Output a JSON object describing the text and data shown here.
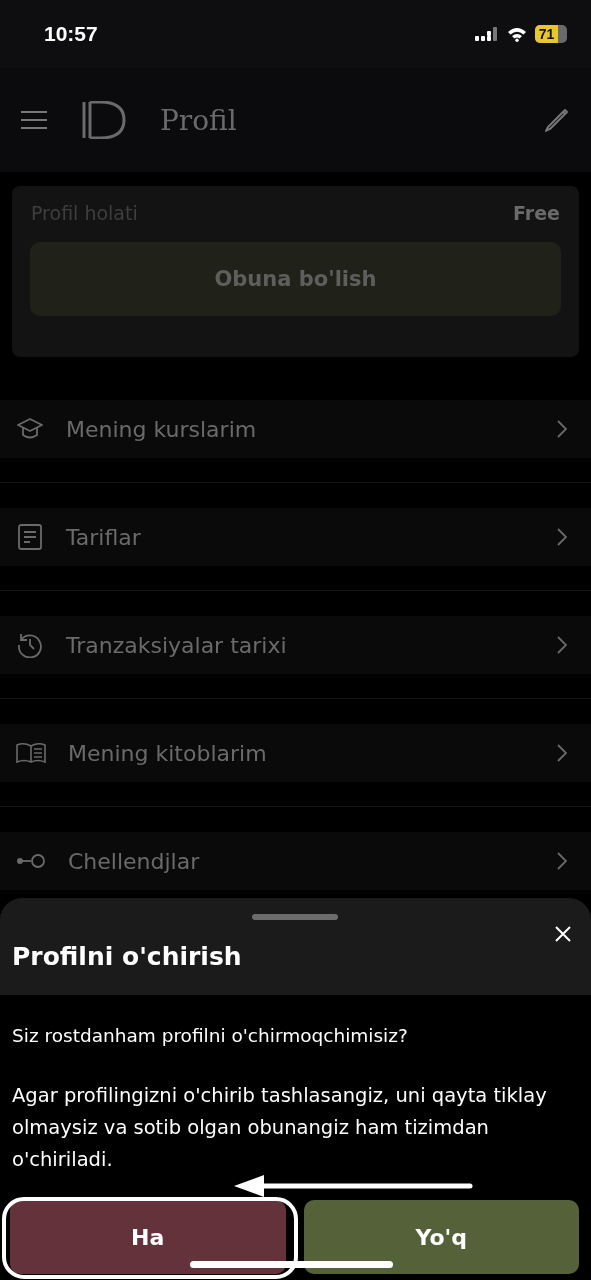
{
  "status_bar": {
    "time": "10:57",
    "battery": "71"
  },
  "header": {
    "title": "Profil"
  },
  "profile_card": {
    "label": "Profil holati",
    "value": "Free",
    "button": "Obuna bo'lish"
  },
  "menu": [
    {
      "label": "Mening kurslarim"
    },
    {
      "label": "Tariflar"
    },
    {
      "label": "Tranzaksiyalar tarixi"
    },
    {
      "label": "Mening kitoblarim"
    },
    {
      "label": "Chellendjlar"
    }
  ],
  "sheet": {
    "title": "Profilni o'chirish",
    "question": "Siz rostdanham profilni o'chirmoqchimisiz?",
    "message": "Agar profilingizni o'chirib tashlasangiz, uni qayta tiklay olmaysiz va sotib olgan obunangiz ham tizimdan o'chiriladi.",
    "buttons": [
      {
        "label": "Ha",
        "kind": "danger"
      },
      {
        "label": "Yo'q",
        "kind": "confirm"
      }
    ]
  }
}
